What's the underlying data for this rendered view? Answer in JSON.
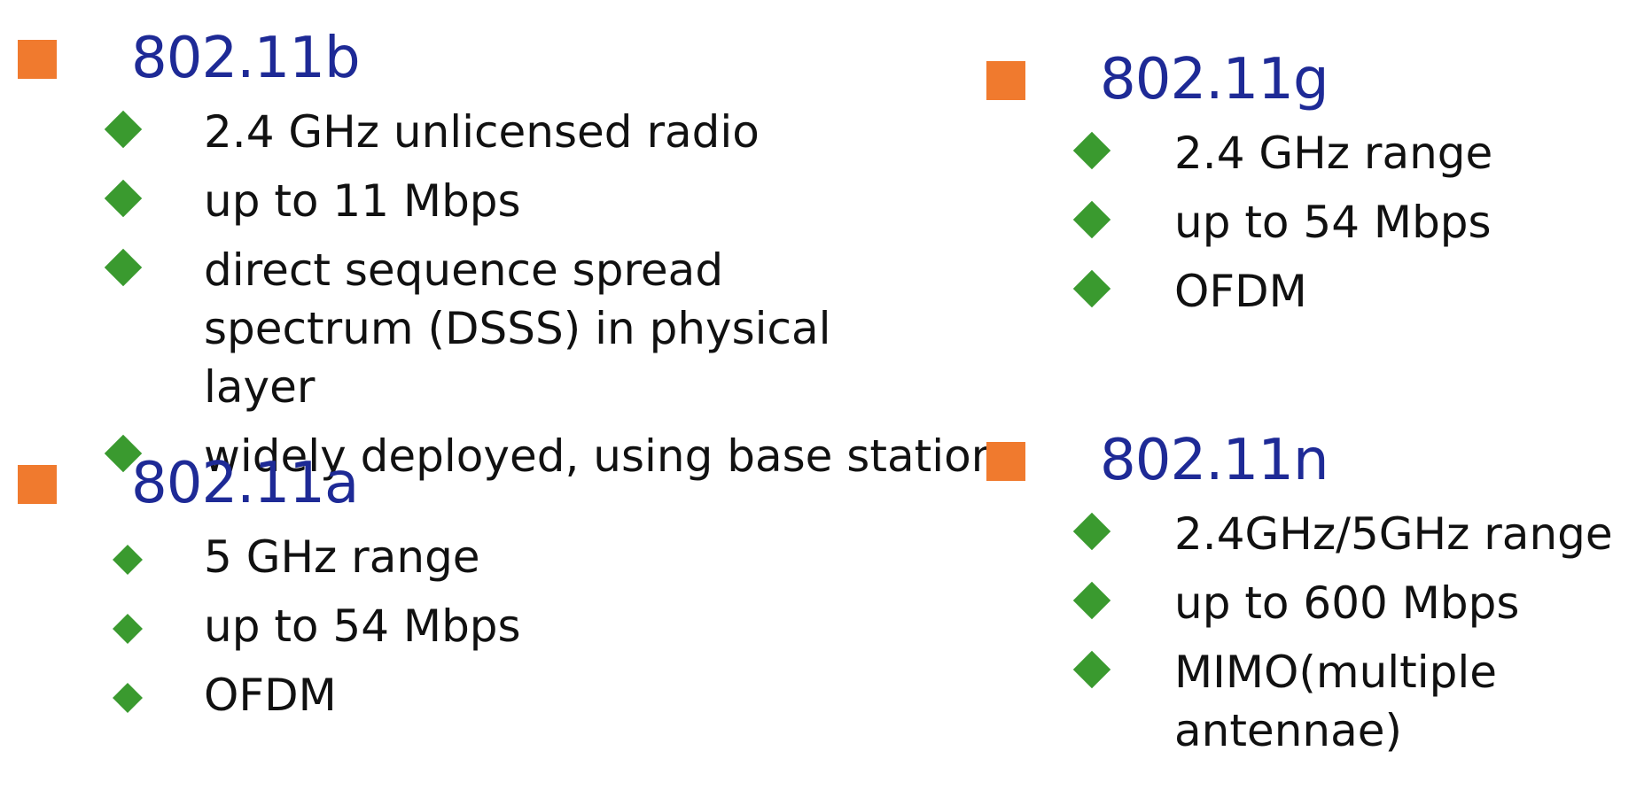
{
  "sections": {
    "b": {
      "title": "802.11b",
      "items": [
        "2.4 GHz unlicensed radio",
        "up to 11 Mbps",
        "direct sequence spread spectrum (DSSS) in physical layer",
        "widely deployed, using base stations"
      ]
    },
    "a": {
      "title": "802.11a",
      "items": [
        "5 GHz range",
        "up to 54 Mbps",
        "OFDM"
      ]
    },
    "g": {
      "title": "802.11g",
      "items": [
        "2.4 GHz range",
        "up to 54 Mbps",
        "OFDM"
      ]
    },
    "n": {
      "title": "802.11n",
      "items": [
        "2.4GHz/5GHz range",
        "up to 600 Mbps",
        "MIMO(multiple antennae)"
      ]
    }
  },
  "colors": {
    "heading": "#1e2a96",
    "square_bullet": "#f07a2e",
    "diamond_bullet": "#3a9a2f",
    "text": "#111111"
  },
  "icons": {
    "section_bullet": "square-bullet-icon",
    "item_bullet": "diamond-bullet-icon"
  }
}
